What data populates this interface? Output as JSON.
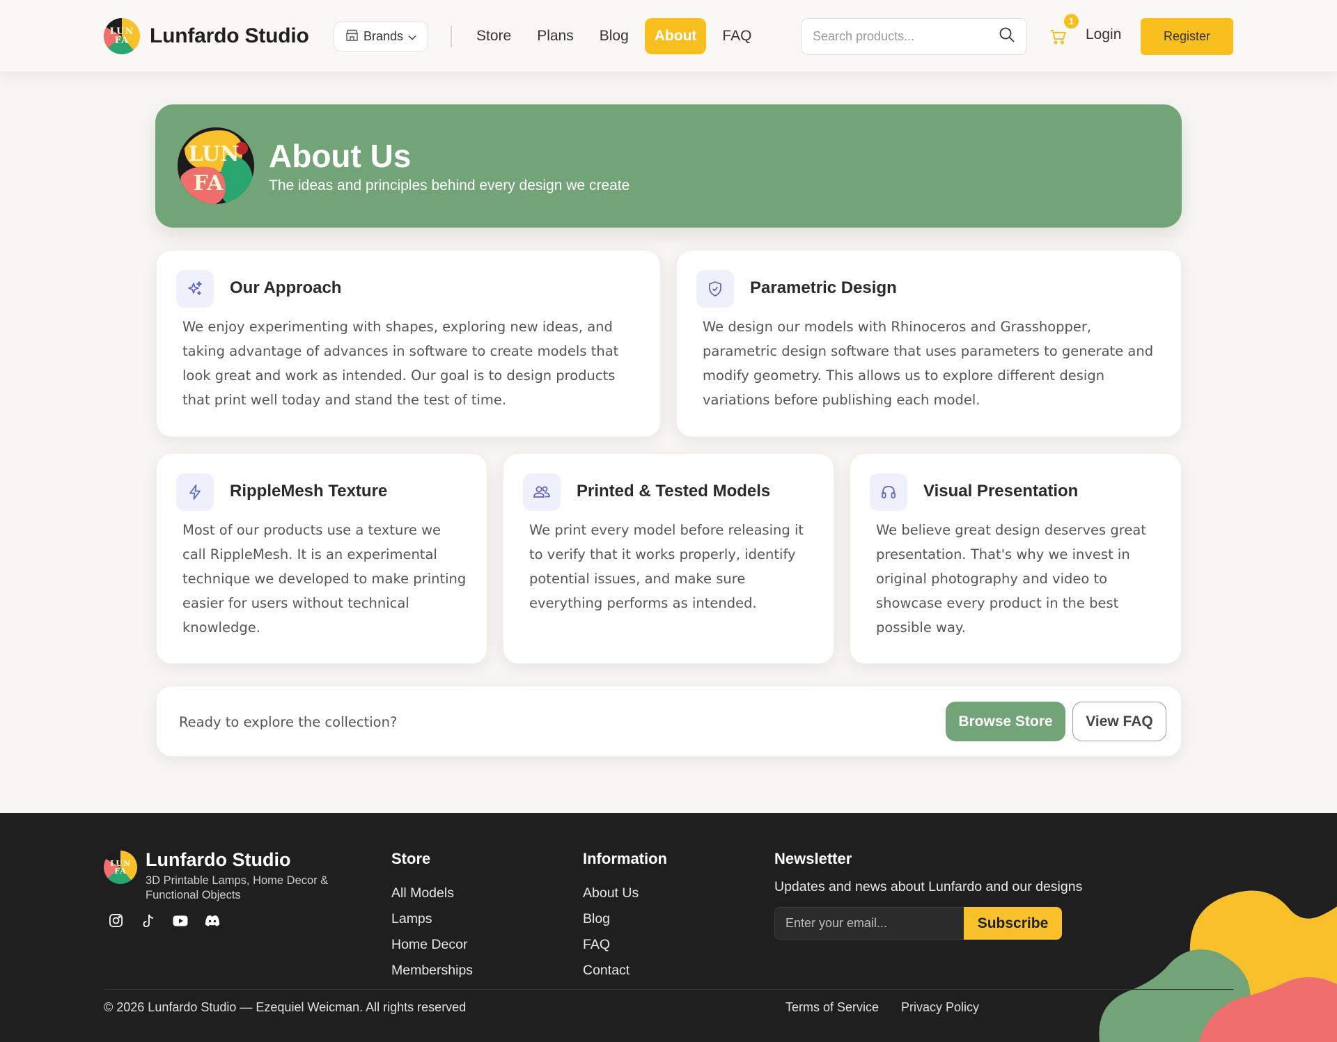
{
  "header": {
    "brand_name": "Lunfardo Studio",
    "brands_label": "Brands",
    "nav": [
      {
        "label": "Store",
        "active": false
      },
      {
        "label": "Plans",
        "active": false
      },
      {
        "label": "Blog",
        "active": false
      },
      {
        "label": "About",
        "active": true
      },
      {
        "label": "FAQ",
        "active": false
      }
    ],
    "search_placeholder": "Search products...",
    "cart_count": "1",
    "login_label": "Login",
    "register_label": "Register"
  },
  "hero": {
    "title": "About Us",
    "subtitle": "The ideas and principles behind every design we create",
    "logo_text_top": "LUN",
    "logo_text_bottom": "FA"
  },
  "cards": [
    {
      "icon": "sparkles-icon",
      "title": "Our Approach",
      "text": "We enjoy experimenting with shapes, exploring new ideas, and taking advantage of advances in software to create models that look great and work as intended. Our goal is to design products that print well today and stand the test of time."
    },
    {
      "icon": "shield-icon",
      "title": "Parametric Design",
      "text": "We design our models with Rhinoceros and Grasshopper, parametric design software that uses parameters to generate and modify geometry. This allows us to explore different design variations before publishing each model."
    },
    {
      "icon": "lightning-icon",
      "title": "RippleMesh Texture",
      "text": "Most of our products use a texture we call RippleMesh. It is an experimental technique we developed to make printing easier for users without technical knowledge."
    },
    {
      "icon": "users-icon",
      "title": "Printed & Tested Models",
      "text": "We print every model before releasing it to verify that it works properly, identify potential issues, and make sure everything performs as intended."
    },
    {
      "icon": "headphones-icon",
      "title": "Visual Presentation",
      "text": "We believe great design deserves great presentation. That's why we invest in original photography and video to showcase every product in the best possible way."
    }
  ],
  "cta": {
    "text": "Ready to explore the collection?",
    "browse_label": "Browse Store",
    "faq_label": "View FAQ"
  },
  "footer": {
    "brand_name": "Lunfardo Studio",
    "tagline": "3D Printable Lamps, Home Decor & Functional Objects",
    "socials": [
      "instagram-icon",
      "tiktok-icon",
      "youtube-icon",
      "discord-icon"
    ],
    "store": {
      "heading": "Store",
      "links": [
        "All Models",
        "Lamps",
        "Home Decor",
        "Memberships"
      ]
    },
    "information": {
      "heading": "Information",
      "links": [
        "About Us",
        "Blog",
        "FAQ",
        "Contact"
      ]
    },
    "newsletter": {
      "heading": "Newsletter",
      "subtitle": "Updates and news about Lunfardo and our designs",
      "placeholder": "Enter your email...",
      "button": "Subscribe"
    },
    "copyright": "© 2026 Lunfardo Studio — Ezequiel Weicman. All rights reserved",
    "terms": "Terms of Service",
    "privacy": "Privacy Policy"
  },
  "colors": {
    "accent_yellow": "#f8bf1e",
    "accent_green": "#72a477",
    "accent_coral": "#ef6f6c",
    "footer_bg": "#1f1f1f",
    "page_bg": "#f7f6f3"
  }
}
